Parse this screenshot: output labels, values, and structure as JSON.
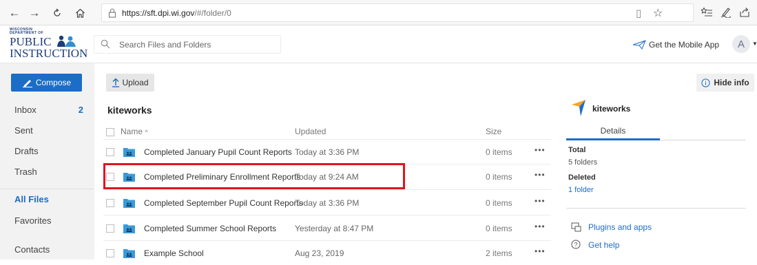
{
  "browser": {
    "url_host": "https://sft.dpi.wi.gov",
    "url_path": "/#/folder/0"
  },
  "logo": {
    "line_small1": "WISCONSIN",
    "line_small2": "DEPARTMENT OF",
    "line1": "PUBLIC",
    "line2": "INSTRUCTION"
  },
  "header": {
    "search_placeholder": "Search Files and Folders",
    "mobile_app_label": "Get the Mobile App",
    "avatar_initial": "A"
  },
  "sidebar": {
    "compose_label": "Compose",
    "items": [
      {
        "label": "Inbox",
        "count": "2"
      },
      {
        "label": "Sent"
      },
      {
        "label": "Drafts"
      },
      {
        "label": "Trash"
      },
      {
        "label": "All Files",
        "active": true
      },
      {
        "label": "Favorites"
      },
      {
        "label": "Contacts"
      }
    ]
  },
  "main": {
    "upload_label": "Upload",
    "folder_title": "kiteworks",
    "columns": {
      "name": "Name",
      "updated": "Updated",
      "size": "Size"
    },
    "rows": [
      {
        "name": "Completed January Pupil Count Reports",
        "updated": "Today at 3:36 PM",
        "size": "0 items"
      },
      {
        "name": "Completed Preliminary Enrollment Reports",
        "updated": "Today at 9:24 AM",
        "size": "0 items"
      },
      {
        "name": "Completed September Pupil Count Reports",
        "updated": "Today at 3:36 PM",
        "size": "0 items"
      },
      {
        "name": "Completed Summer School Reports",
        "updated": "Yesterday at 8:47 PM",
        "size": "0 items"
      },
      {
        "name": "Example School",
        "updated": "Aug 23, 2019",
        "size": "2 items"
      }
    ],
    "more_label": "•••"
  },
  "info": {
    "hide_label": "Hide info",
    "title": "kiteworks",
    "tab_details": "Details",
    "total_label": "Total",
    "total_value": "5 folders",
    "deleted_label": "Deleted",
    "deleted_value": "1 folder",
    "plugins_label": "Plugins and apps",
    "help_label": "Get help"
  },
  "colors": {
    "accent": "#1c6dc6",
    "highlight": "#e0141e"
  }
}
